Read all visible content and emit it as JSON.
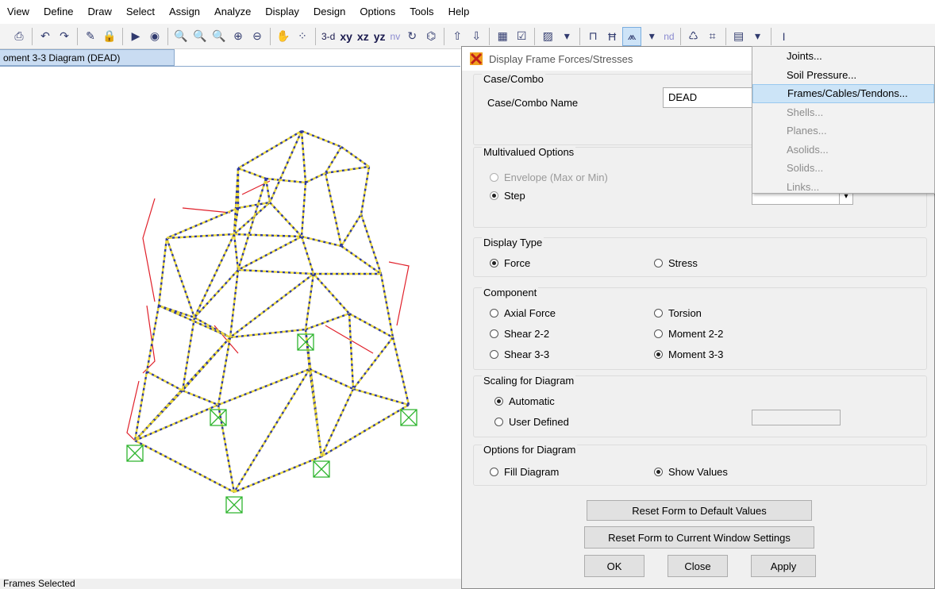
{
  "menubar": [
    "View",
    "Define",
    "Draw",
    "Select",
    "Assign",
    "Analyze",
    "Display",
    "Design",
    "Options",
    "Tools",
    "Help"
  ],
  "toolbar": {
    "view_3d": "3-d",
    "view_xy": "xy",
    "view_xz": "xz",
    "view_yz": "yz",
    "view_nv": "nv",
    "nd": "nd"
  },
  "window_tab": "oment 3-3 Diagram (DEAD)",
  "status": "Frames Selected",
  "dialog": {
    "title": "Display Frame Forces/Stresses",
    "case_combo": {
      "group": "Case/Combo",
      "label": "Case/Combo Name",
      "value": "DEAD"
    },
    "multivalued": {
      "group": "Multivalued Options",
      "envelope": "Envelope (Max or Min)",
      "step": "Step"
    },
    "display_type": {
      "group": "Display Type",
      "force": "Force",
      "stress": "Stress"
    },
    "component": {
      "group": "Component",
      "axial": "Axial Force",
      "torsion": "Torsion",
      "shear22": "Shear 2-2",
      "moment22": "Moment 2-2",
      "shear33": "Shear 3-3",
      "moment33": "Moment 3-3"
    },
    "scaling": {
      "group": "Scaling for Diagram",
      "automatic": "Automatic",
      "user_defined": "User Defined"
    },
    "options": {
      "group": "Options for Diagram",
      "fill": "Fill Diagram",
      "show_values": "Show Values"
    },
    "buttons": {
      "reset_default": "Reset Form to Default Values",
      "reset_current": "Reset Form to Current Window Settings",
      "ok": "OK",
      "close": "Close",
      "apply": "Apply"
    }
  },
  "dropdown_menu": {
    "items": [
      "Joints...",
      "Soil Pressure...",
      "Frames/Cables/Tendons...",
      "Shells...",
      "Planes...",
      "Asolids...",
      "Solids...",
      "Links..."
    ],
    "selected": "Frames/Cables/Tendons..."
  },
  "colors": {
    "accent": "#cce4f7",
    "frame_member": "#2e3a9c",
    "diagram_red": "#e0202a",
    "support": "#2fb52f"
  }
}
